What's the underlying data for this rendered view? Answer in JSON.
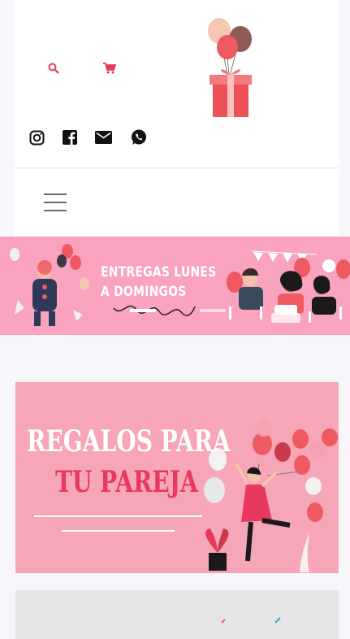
{
  "header": {
    "icons": {
      "search": "search-icon",
      "cart": "cart-icon",
      "logo": "gift-balloons-logo"
    },
    "social": [
      "instagram-icon",
      "facebook-icon",
      "email-icon",
      "whatsapp-icon"
    ]
  },
  "nav": {
    "menu_icon": "hamburger-menu-icon"
  },
  "banner": {
    "line1": "ENTREGAS LUNES",
    "line2": "A DOMINGOS"
  },
  "category_card": {
    "line1": "REGALOS PARA",
    "line2": "TU PAREJA"
  },
  "colors": {
    "accent": "#e8385c",
    "banner_bg": "#f9a3be",
    "card_bg": "#f6a6b6"
  }
}
